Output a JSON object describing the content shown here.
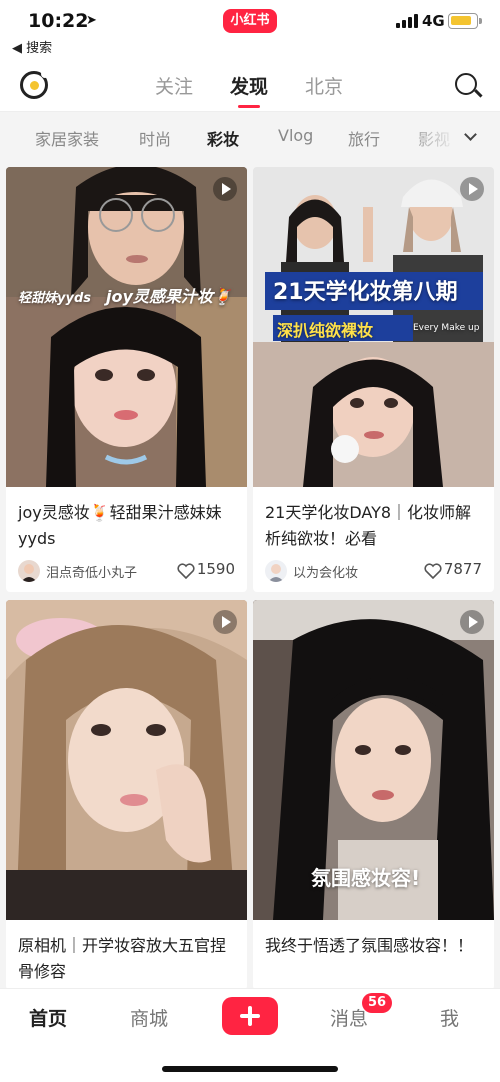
{
  "status_bar": {
    "time": "10:22",
    "back_label": "◀ 搜索",
    "app_badge": "小红书",
    "network": "4G",
    "battery_level": 0.7,
    "battery_color": "#f4c430"
  },
  "top_nav": {
    "tabs": [
      {
        "label": "关注",
        "active": false
      },
      {
        "label": "发现",
        "active": true
      },
      {
        "label": "北京",
        "active": false
      }
    ],
    "accent_color": "#ff2442"
  },
  "categories": {
    "items": [
      "家居家装",
      "时尚",
      "彩妆",
      "Vlog",
      "旅行",
      "影视"
    ],
    "selected": "彩妆"
  },
  "feed": [
    {
      "title": "joy灵感妆🍹轻甜果汁感妹妹yyds",
      "overlay_text_1": "轻甜妹yyds",
      "overlay_text_2": "joy灵感果汁妆🍹",
      "author": "泪点奇低小丸子",
      "likes": "1590",
      "is_video": true
    },
    {
      "title": "21天学化妆DAY8｜化妆师解析纯欲妆！必看",
      "overlay_text_1": "21天学化妆第八期",
      "overlay_text_2": "深扒纯欲裸妆",
      "overlay_text_3": "Every Make up",
      "author": "以为会化妆",
      "likes": "7877",
      "is_video": true
    },
    {
      "title": "原相机｜开学妆容放大五官捏骨修容",
      "is_video": true
    },
    {
      "title": "我终于悟透了氛围感妆容！！",
      "overlay_text_1": "氛围感妆容!",
      "is_video": true
    }
  ],
  "tab_bar": {
    "items": [
      {
        "label": "首页",
        "active": true
      },
      {
        "label": "商城",
        "active": false
      },
      {
        "label": "消息",
        "active": false
      },
      {
        "label": "我",
        "active": false
      }
    ],
    "messages_badge": "56"
  }
}
